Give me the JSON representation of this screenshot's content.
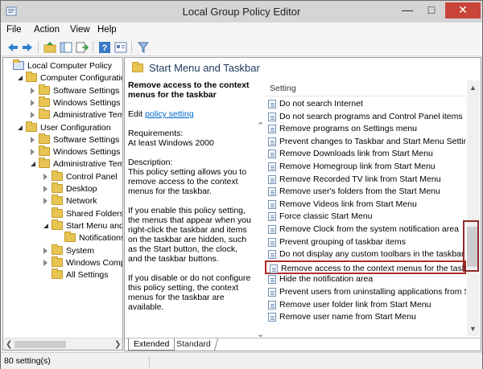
{
  "window": {
    "title": "Local Group Policy Editor"
  },
  "menu": [
    "File",
    "Action",
    "View",
    "Help"
  ],
  "tree": [
    {
      "label": "Local Computer Policy",
      "indent": 0,
      "state": "none"
    },
    {
      "label": "Computer Configuratio",
      "indent": 1,
      "state": "expanded"
    },
    {
      "label": "Software Settings",
      "indent": 2,
      "state": "collapsed"
    },
    {
      "label": "Windows Settings",
      "indent": 2,
      "state": "collapsed"
    },
    {
      "label": "Administrative Tem",
      "indent": 2,
      "state": "collapsed"
    },
    {
      "label": "User Configuration",
      "indent": 1,
      "state": "expanded"
    },
    {
      "label": "Software Settings",
      "indent": 2,
      "state": "collapsed"
    },
    {
      "label": "Windows Settings",
      "indent": 2,
      "state": "collapsed"
    },
    {
      "label": "Administrative Temp",
      "indent": 2,
      "state": "expanded"
    },
    {
      "label": "Control Panel",
      "indent": 3,
      "state": "collapsed"
    },
    {
      "label": "Desktop",
      "indent": 3,
      "state": "collapsed"
    },
    {
      "label": "Network",
      "indent": 3,
      "state": "collapsed"
    },
    {
      "label": "Shared Folders",
      "indent": 3,
      "state": "none"
    },
    {
      "label": "Start Menu and T",
      "indent": 3,
      "state": "expanded"
    },
    {
      "label": "Notifications",
      "indent": 4,
      "state": "none"
    },
    {
      "label": "System",
      "indent": 3,
      "state": "collapsed"
    },
    {
      "label": "Windows Compo",
      "indent": 3,
      "state": "collapsed"
    },
    {
      "label": "All Settings",
      "indent": 3,
      "state": "none"
    }
  ],
  "header": {
    "title": "Start Menu and Taskbar"
  },
  "description": {
    "heading": "Remove access to the context menus for the taskbar",
    "edit_prefix": "Edit ",
    "edit_link": "policy setting",
    "requirements_label": "Requirements:",
    "requirements_value": "At least Windows 2000",
    "description_label": "Description:",
    "description_text": "This policy setting allows you to remove access to the context menus for the taskbar.",
    "enable_text": "If you enable this policy setting, the menus that appear when you right-click the taskbar and items on the taskbar are hidden, such as the Start button, the clock, and the taskbar buttons.",
    "disable_text": "If you disable or do not configure this policy setting, the context menus for the taskbar are available."
  },
  "list": {
    "column_header": "Setting",
    "selected_index": 14,
    "items": [
      "Do not search Internet",
      "Do not search programs and Control Panel items",
      "Remove programs on Settings menu",
      "Prevent changes to Taskbar and Start Menu Settings",
      "Remove Downloads link from Start Menu",
      "Remove Homegroup link from Start Menu",
      "Remove Recorded TV link from Start Menu",
      "Remove user's folders from the Start Menu",
      "Remove Videos link from Start Menu",
      "Force classic Start Menu",
      "Remove Clock from the system notification area",
      "Prevent grouping of taskbar items",
      "Do not display any custom toolbars in the taskbar",
      "Remove access to the context menus for the taskbar",
      "Hide the notification area",
      "Prevent users from uninstalling applications from Sta",
      "Remove user folder link from Start Menu",
      "Remove user name from Start Menu"
    ]
  },
  "tabs": {
    "extended": "Extended",
    "standard": "Standard"
  },
  "status": {
    "count": "80 setting(s)"
  }
}
